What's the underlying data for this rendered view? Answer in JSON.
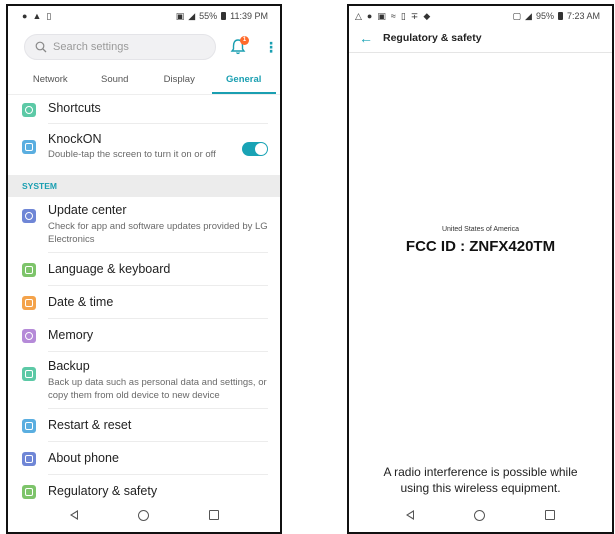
{
  "left_phone": {
    "status": {
      "battery": "55%",
      "time": "11:39 PM"
    },
    "search": {
      "placeholder": "Search settings"
    },
    "notification_count": "1",
    "tabs": [
      {
        "label": "Network",
        "active": false
      },
      {
        "label": "Sound",
        "active": false
      },
      {
        "label": "Display",
        "active": false
      },
      {
        "label": "General",
        "active": true
      }
    ],
    "items_top": [
      {
        "title": "Shortcuts",
        "icon": "shortcuts-icon",
        "color": "#5cc9a6"
      },
      {
        "title": "KnockON",
        "subtitle": "Double-tap the screen to turn it on or off",
        "icon": "knockon-icon",
        "color": "#5aaee0",
        "toggle_on": true
      }
    ],
    "section_header": "SYSTEM",
    "items_system": [
      {
        "title": "Update center",
        "subtitle": "Check for app and software updates provided by LG Electronics",
        "icon": "update-icon",
        "color": "#6f86d6"
      },
      {
        "title": "Language & keyboard",
        "icon": "language-icon",
        "color": "#7dc46a"
      },
      {
        "title": "Date & time",
        "icon": "date-time-icon",
        "color": "#f4a34b"
      },
      {
        "title": "Memory",
        "icon": "memory-icon",
        "color": "#b58ad8"
      },
      {
        "title": "Backup",
        "subtitle": "Back up data such as personal data and settings, or copy them from old device to new device",
        "icon": "backup-icon",
        "color": "#5cc9a6"
      },
      {
        "title": "Restart & reset",
        "icon": "restart-icon",
        "color": "#5aaee0"
      },
      {
        "title": "About phone",
        "icon": "about-icon",
        "color": "#6f86d6"
      },
      {
        "title": "Regulatory & safety",
        "icon": "regulatory-icon",
        "color": "#7dc46a"
      }
    ]
  },
  "right_phone": {
    "status": {
      "battery": "95%",
      "time": "7:23 AM"
    },
    "title": "Regulatory & safety",
    "country": "United States of America",
    "fcc_id": "FCC ID : ZNFX420TM",
    "warning": "A radio interference is possible while using this wireless equipment."
  },
  "colors": {
    "accent": "#1a9fb1",
    "toggle": "#19a3b5",
    "badge": "#ff6a2b"
  }
}
